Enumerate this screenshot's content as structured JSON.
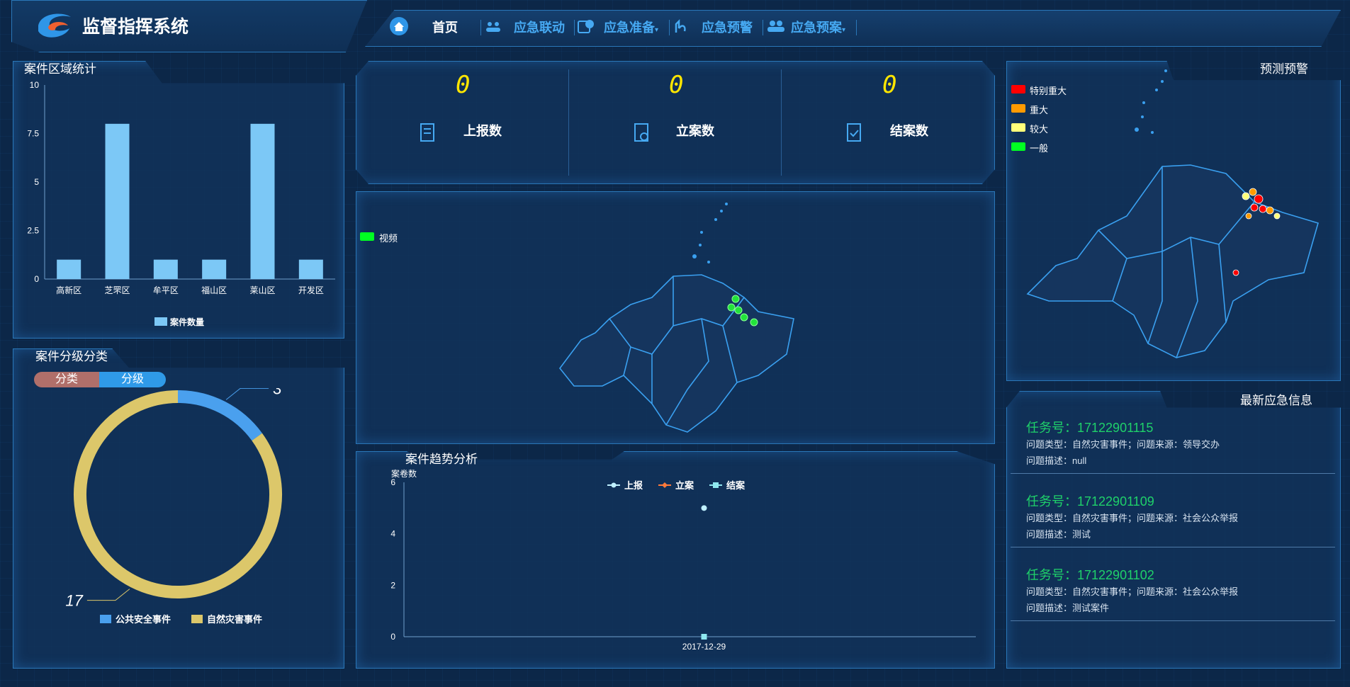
{
  "app": {
    "title": "监督指挥系统"
  },
  "nav": {
    "items": [
      {
        "label": "首页",
        "icon": "home-icon"
      },
      {
        "label": "应急联动",
        "icon": "people-icon"
      },
      {
        "label": "应急准备",
        "icon": "shield-icon",
        "dropdown": true
      },
      {
        "label": "应急预警",
        "icon": "alert-hand-icon"
      },
      {
        "label": "应急预案",
        "icon": "users-icon",
        "dropdown": true
      }
    ]
  },
  "region_panel": {
    "title": "案件区域统计"
  },
  "grade_panel": {
    "title": "案件分级分类",
    "toggle_left": "分类",
    "toggle_right": "分级"
  },
  "stats": {
    "items": [
      {
        "value": "0",
        "label": "上报数",
        "icon": "report-icon"
      },
      {
        "value": "0",
        "label": "立案数",
        "icon": "file-register-icon"
      },
      {
        "value": "0",
        "label": "结案数",
        "icon": "file-check-icon"
      }
    ]
  },
  "map_center": {
    "legend": "视频",
    "legend_color": "#00ff22"
  },
  "map_right": {
    "title": "预测预警",
    "legend": [
      {
        "label": "特别重大",
        "color": "#ff0000"
      },
      {
        "label": "重大",
        "color": "#ff9a00"
      },
      {
        "label": "较大",
        "color": "#ffff7a"
      },
      {
        "label": "一般",
        "color": "#00ff22"
      }
    ]
  },
  "trend_panel": {
    "title": "案件趋势分析"
  },
  "info_panel": {
    "title": "最新应急信息",
    "items": [
      {
        "title": "任务号：17122901115",
        "line1": "问题类型：自然灾害事件；问题来源：领导交办",
        "line2": "问题描述：null"
      },
      {
        "title": "任务号：17122901109",
        "line1": "问题类型：自然灾害事件；问题来源：社会公众举报",
        "line2": "问题描述：测试"
      },
      {
        "title": "任务号：17122901102",
        "line1": "问题类型：自然灾害事件；问题来源：社会公众举报",
        "line2": "问题描述：测试案件"
      }
    ]
  },
  "colors": {
    "accent": "#46a9f2",
    "bar": "#7cc8f6",
    "donut_a": "#4aa0ee",
    "donut_b": "#dcc76a"
  },
  "chart_data": [
    {
      "type": "bar",
      "categories": [
        "高新区",
        "芝罘区",
        "牟平区",
        "福山区",
        "莱山区",
        "开发区"
      ],
      "series": [
        {
          "name": "案件数量",
          "values": [
            1,
            8,
            1,
            1,
            8,
            1
          ]
        }
      ],
      "yticks": [
        "0",
        "2.5",
        "5",
        "7.5",
        "10"
      ],
      "ylim": [
        0,
        10
      ]
    },
    {
      "type": "pie",
      "labels": [
        "公共安全事件",
        "自然灾害事件"
      ],
      "values": [
        3,
        17
      ],
      "value_labels": [
        "3",
        "17"
      ]
    },
    {
      "type": "line",
      "ylabel": "案卷数",
      "x": [
        "2017-12-29"
      ],
      "series": [
        {
          "name": "上报",
          "values": [
            5
          ]
        },
        {
          "name": "立案",
          "values": [
            0
          ]
        },
        {
          "name": "结案",
          "values": [
            0
          ]
        }
      ],
      "yticks": [
        "0",
        "2",
        "4",
        "6"
      ],
      "ylim": [
        0,
        6
      ]
    }
  ]
}
